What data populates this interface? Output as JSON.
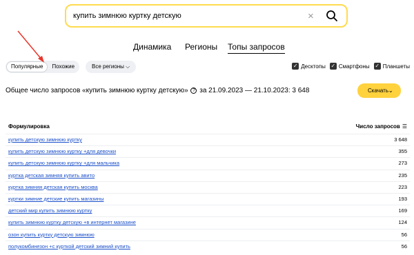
{
  "search": {
    "value": "купить зимнюю куртку детскую",
    "clear_icon": "close-icon",
    "search_icon": "search-icon"
  },
  "tabs": [
    {
      "label": "Динамика",
      "active": false
    },
    {
      "label": "Регионы",
      "active": false
    },
    {
      "label": "Топы запросов",
      "active": true
    }
  ],
  "mode": {
    "options": [
      {
        "label": "Популярные",
        "selected": true
      },
      {
        "label": "Похожие",
        "selected": false
      }
    ]
  },
  "regions": {
    "label": "Все регионы"
  },
  "devices": [
    {
      "label": "Десктопы",
      "checked": true
    },
    {
      "label": "Смартфоны",
      "checked": true
    },
    {
      "label": "Планшеты",
      "checked": true
    }
  ],
  "summary": {
    "prefix": "Общее число запросов «купить зимнюю куртку детскую»",
    "suffix": "за 21.09.2023 — 21.10.2023: 3 648"
  },
  "download": {
    "label": "Скачать"
  },
  "table": {
    "col_query": "Формулировка",
    "col_count": "Число запросов",
    "rows": [
      {
        "query": "купить детскую зимнюю куртку",
        "count": "3 648"
      },
      {
        "query": "купить детскую зимнюю куртку +для девочки",
        "count": "355"
      },
      {
        "query": "купить детскую зимнюю куртку +для мальчика",
        "count": "273"
      },
      {
        "query": "куртка детская зимняя купить авито",
        "count": "235"
      },
      {
        "query": "куртка зимняя детская купить москва",
        "count": "223"
      },
      {
        "query": "куртки зимние детские купить магазины",
        "count": "193"
      },
      {
        "query": "детский мир купить зимнюю куртку",
        "count": "169"
      },
      {
        "query": "купить зимнюю куртку детскую +в интернет магазине",
        "count": "124"
      },
      {
        "query": "озон купить куртку детскую зимнюю",
        "count": "56"
      },
      {
        "query": "полукомбинезон +с курткой детский зимний купить",
        "count": "56"
      }
    ]
  },
  "colors": {
    "accent_yellow": "#ffd23e",
    "link_blue": "#1a4fc9",
    "annotation_arrow": "#e8352b"
  }
}
